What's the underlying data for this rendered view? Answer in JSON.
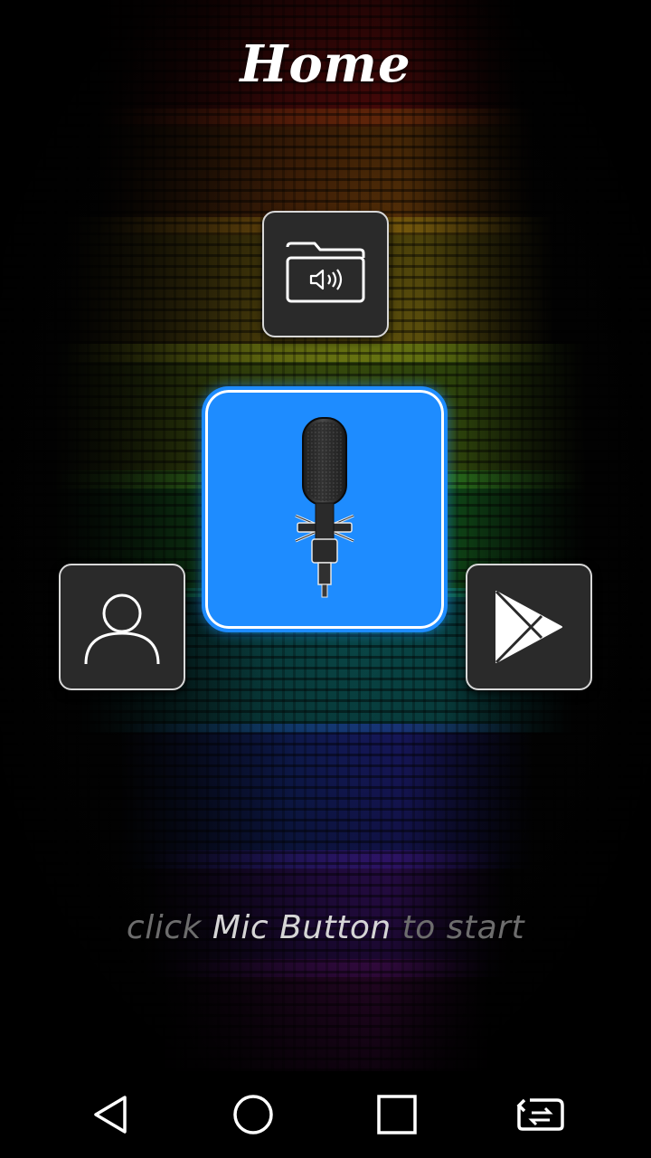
{
  "header": {
    "title": "Home"
  },
  "tiles": {
    "folder": {
      "icon": "audio-folder-icon"
    },
    "mic": {
      "icon": "microphone-icon",
      "color": "#1e8cff"
    },
    "profile": {
      "icon": "user-profile-icon"
    },
    "store": {
      "icon": "play-store-icon"
    }
  },
  "hint": {
    "prefix": "click ",
    "highlight": "Mic Button",
    "suffix": " to start"
  },
  "navbar": {
    "items": [
      "back-icon",
      "home-icon",
      "recents-icon",
      "switch-app-icon"
    ]
  },
  "background": {
    "bands": [
      "#ff1a1a",
      "#ff7a1a",
      "#ffd21a",
      "#b8e01a",
      "#2ed13a",
      "#1ad1d1",
      "#1a5aff",
      "#7a1aff",
      "#d11ad1"
    ]
  }
}
